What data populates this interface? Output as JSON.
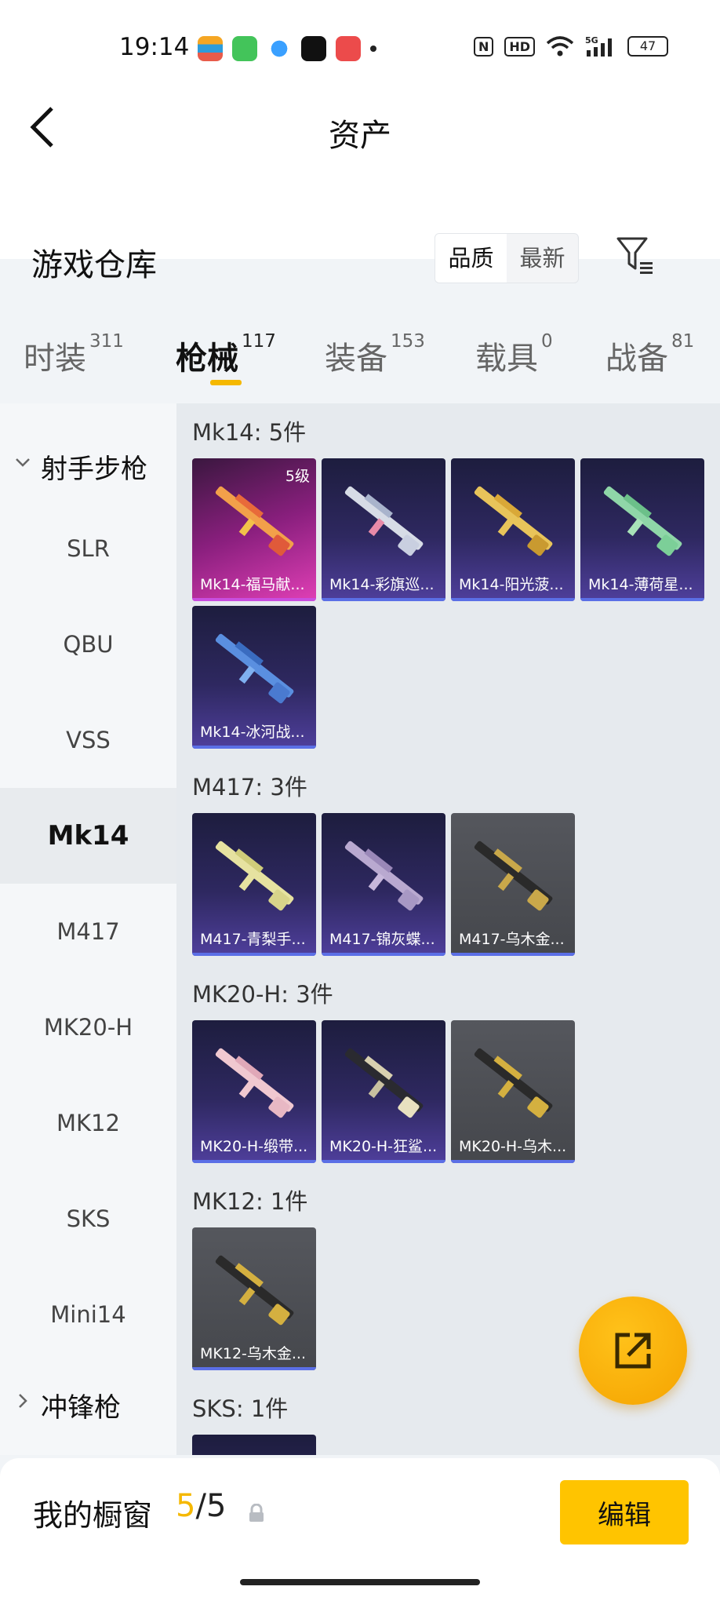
{
  "status_bar": {
    "time": "19:14",
    "battery": "47",
    "network": "5G"
  },
  "nav": {
    "title": "资产"
  },
  "warehouse": {
    "title": "游戏仓库",
    "sort_options": [
      "品质",
      "最新"
    ],
    "active_sort": "品质"
  },
  "category_tabs": [
    {
      "label": "时装",
      "count": "311"
    },
    {
      "label": "枪械",
      "count": "117"
    },
    {
      "label": "装备",
      "count": "153"
    },
    {
      "label": "载具",
      "count": "0"
    },
    {
      "label": "战备",
      "count": "81"
    }
  ],
  "sidebar": {
    "group1": "射手步枪",
    "items": [
      "SLR",
      "QBU",
      "VSS",
      "Mk14",
      "M417",
      "MK20-H",
      "MK12",
      "SKS",
      "Mini14"
    ],
    "active_item": "Mk14",
    "group2": "冲锋枪"
  },
  "sections": [
    {
      "title": "Mk14: 5件",
      "items": [
        {
          "name": "Mk14-福马献...",
          "level": "5级",
          "rarity": "pink"
        },
        {
          "name": "Mk14-彩旗巡...",
          "rarity": "purple"
        },
        {
          "name": "Mk14-阳光菠...",
          "rarity": "purple"
        },
        {
          "name": "Mk14-薄荷星...",
          "rarity": "purple"
        },
        {
          "name": "Mk14-冰河战...",
          "rarity": "purple"
        }
      ]
    },
    {
      "title": "M417: 3件",
      "items": [
        {
          "name": "M417-青梨手...",
          "rarity": "purple"
        },
        {
          "name": "M417-锦灰蝶...",
          "rarity": "purple"
        },
        {
          "name": "M417-乌木金...",
          "rarity": "gray"
        }
      ]
    },
    {
      "title": "MK20-H: 3件",
      "items": [
        {
          "name": "MK20-H-缎带...",
          "rarity": "purple"
        },
        {
          "name": "MK20-H-狂鲨...",
          "rarity": "purple"
        },
        {
          "name": "MK20-H-乌木...",
          "rarity": "gray"
        }
      ]
    },
    {
      "title": "MK12: 1件",
      "items": [
        {
          "name": "MK12-乌木金...",
          "rarity": "gray"
        }
      ]
    },
    {
      "title": "SKS: 1件",
      "items": []
    }
  ],
  "showcase": {
    "label": "我的橱窗",
    "current": "5",
    "separator": "/",
    "total": "5",
    "edit_label": "编辑"
  },
  "colors": {
    "accent": "#f5b800",
    "fab": "#ffb300"
  }
}
